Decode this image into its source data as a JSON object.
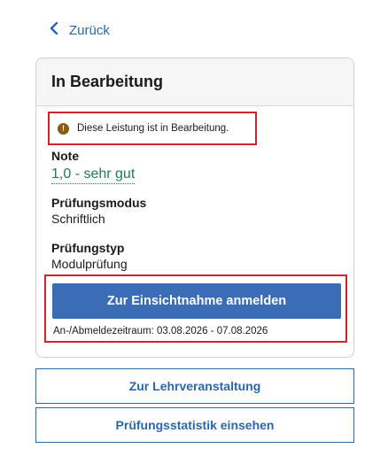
{
  "nav": {
    "back_label": "Zurück"
  },
  "card": {
    "title": "In Bearbeitung",
    "notice": {
      "icon": "exclamation-icon",
      "text": "Diese Leistung ist in Bearbeitung."
    },
    "fields": {
      "grade_label": "Note",
      "grade_value": "1,0 - sehr gut",
      "mode_label": "Prüfungsmodus",
      "mode_value": "Schriftlich",
      "type_label": "Prüfungstyp",
      "type_value": "Modulprüfung"
    },
    "action": {
      "button_label": "Zur Einsichtnahme anmelden",
      "period_text": "An-/Abmeldezeitraum: 03.08.2026 - 07.08.2026"
    }
  },
  "buttons": {
    "course_label": "Zur Lehrveranstaltung",
    "stats_label": "Prüfungsstatistik einsehen"
  },
  "colors": {
    "link": "#2a67a8",
    "primary_button": "#3a6db5",
    "grade": "#1f7a4e",
    "highlight_border": "#d2232a",
    "notice_icon": "#8a5a12"
  }
}
